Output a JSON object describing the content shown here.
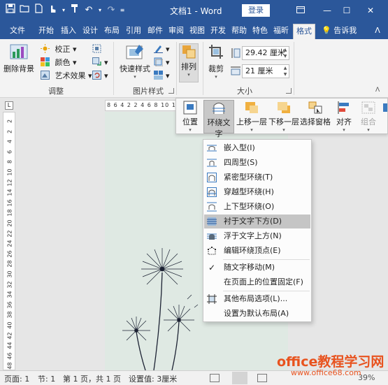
{
  "titlebar": {
    "title": "文档1 - Word",
    "login": "登录",
    "colors": {
      "bar": "#2b579a"
    }
  },
  "tabs": [
    "文件",
    "开始",
    "插入",
    "设计",
    "布局",
    "引用",
    "邮件",
    "审阅",
    "视图",
    "开发",
    "帮助",
    "特色",
    "福昕",
    "格式"
  ],
  "active_tab": "格式",
  "tell_me": "告诉我",
  "ribbon": {
    "adjust": {
      "remove_bg": "删除背景",
      "corrections": "校正",
      "color": "颜色",
      "effects": "艺术效果",
      "label": "调整"
    },
    "styles": {
      "quick": "快速样式",
      "label": "图片样式"
    },
    "arrange": {
      "label": "排列"
    },
    "size": {
      "crop": "裁剪",
      "height": "29.42 厘米",
      "width": "21 厘米",
      "label": "大小"
    }
  },
  "ruler": {
    "h_text": "8 6 4 2  2 4 6 8 10 12",
    "v_ticks": [
      "2",
      "2",
      "4",
      "6",
      "8",
      "10",
      "12",
      "14",
      "16",
      "18",
      "20",
      "22",
      "24",
      "26",
      "28",
      "30",
      "32",
      "34",
      "36",
      "38",
      "40",
      "42",
      "44",
      "46",
      "48"
    ]
  },
  "float_toolbar": [
    {
      "label": "位置",
      "icon": "position-icon"
    },
    {
      "label": "环绕文字",
      "icon": "wrap-text-icon"
    },
    {
      "label": "上移一层",
      "icon": "bring-forward-icon"
    },
    {
      "label": "下移一层",
      "icon": "send-backward-icon"
    },
    {
      "label": "选择窗格",
      "icon": "selection-pane-icon"
    },
    {
      "label": "对齐",
      "icon": "align-icon"
    },
    {
      "label": "组合",
      "icon": "group-icon"
    }
  ],
  "wrap_menu": [
    {
      "label": "嵌入型(I)",
      "icon": "inline-icon"
    },
    {
      "label": "四周型(S)",
      "icon": "square-wrap-icon"
    },
    {
      "label": "紧密型环绕(T)",
      "icon": "tight-wrap-icon"
    },
    {
      "label": "穿越型环绕(H)",
      "icon": "through-wrap-icon"
    },
    {
      "label": "上下型环绕(O)",
      "icon": "top-bottom-wrap-icon"
    },
    {
      "label": "衬于文字下方(D)",
      "icon": "behind-text-icon",
      "highlighted": true
    },
    {
      "label": "浮于文字上方(N)",
      "icon": "in-front-text-icon"
    },
    {
      "label": "编辑环绕顶点(E)",
      "icon": "edit-wrap-points-icon"
    },
    {
      "label": "随文字移动(M)",
      "icon": "check-icon",
      "checked": true
    },
    {
      "label": "在页面上的位置固定(F)",
      "icon": ""
    },
    {
      "label": "其他布局选项(L)...",
      "icon": "layout-options-icon"
    },
    {
      "label": "设置为默认布局(A)",
      "icon": ""
    }
  ],
  "status": {
    "page": "页面: 1",
    "section": "节: 1",
    "page_of": "第 1 页，共 1 页",
    "setting": "设置值: 3厘米",
    "zoom": "39%"
  },
  "watermark": {
    "line1": "office教程学习网",
    "line2": "www.office68.com"
  }
}
